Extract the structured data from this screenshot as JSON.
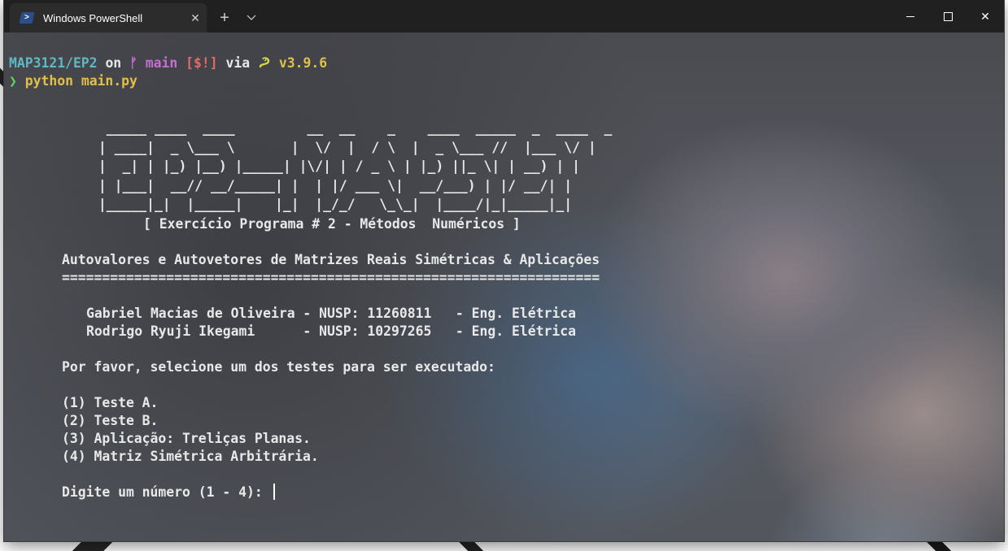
{
  "window": {
    "tab_title": "Windows PowerShell",
    "tab_close": "✕",
    "new_tab": "+",
    "dropdown": "⌵",
    "close": "✕"
  },
  "prompt": {
    "dir": "MAP3121/EP2",
    "on": "on",
    "branch_symbol": "ᚠ",
    "branch": "main",
    "status": "[$!]",
    "via": "via",
    "version": "v3.9.6",
    "arrow": "❯",
    "command": "python main.py"
  },
  "banner": [
    "  _____ ____  ____         __  __    _    ____  _____  _  ____  _",
    " | ____|  _ \\___ \\       |  \\/  |  / \\  |  _ \\___ //  |___ \\/ |",
    " |  _| | |_) |__) |_____| |\\/| | / _ \\ | |_) ||_ \\| | __) | |",
    " | |___|  __// __/_____| |  | |/ ___ \\|  __/___) | |/ __/| |",
    " |_____|_|  |_____|    |_|  |_/_/   \\_\\_|  |____/|_|_____|_|"
  ],
  "subtitle": "[ Exercício Programa # 2 - Métodos  Numéricos ]",
  "heading": "Autovalores e Autovetores de Matrizes Reais Simétricas & Aplicações",
  "rule": "===================================================================",
  "authors": [
    "Gabriel Macias de Oliveira - NUSP: 11260811   - Eng. Elétrica",
    "Rodrigo Ryuji Ikegami      - NUSP: 10297265   - Eng. Elétrica"
  ],
  "instruction": "Por favor, selecione um dos testes para ser executado:",
  "options": [
    "(1) Teste A.",
    "(2) Teste B.",
    "(3) Aplicação: Treliças Planas.",
    "(4) Matriz Simétrica Arbitrária."
  ],
  "input_prompt": "Digite um número (1 - 4): "
}
